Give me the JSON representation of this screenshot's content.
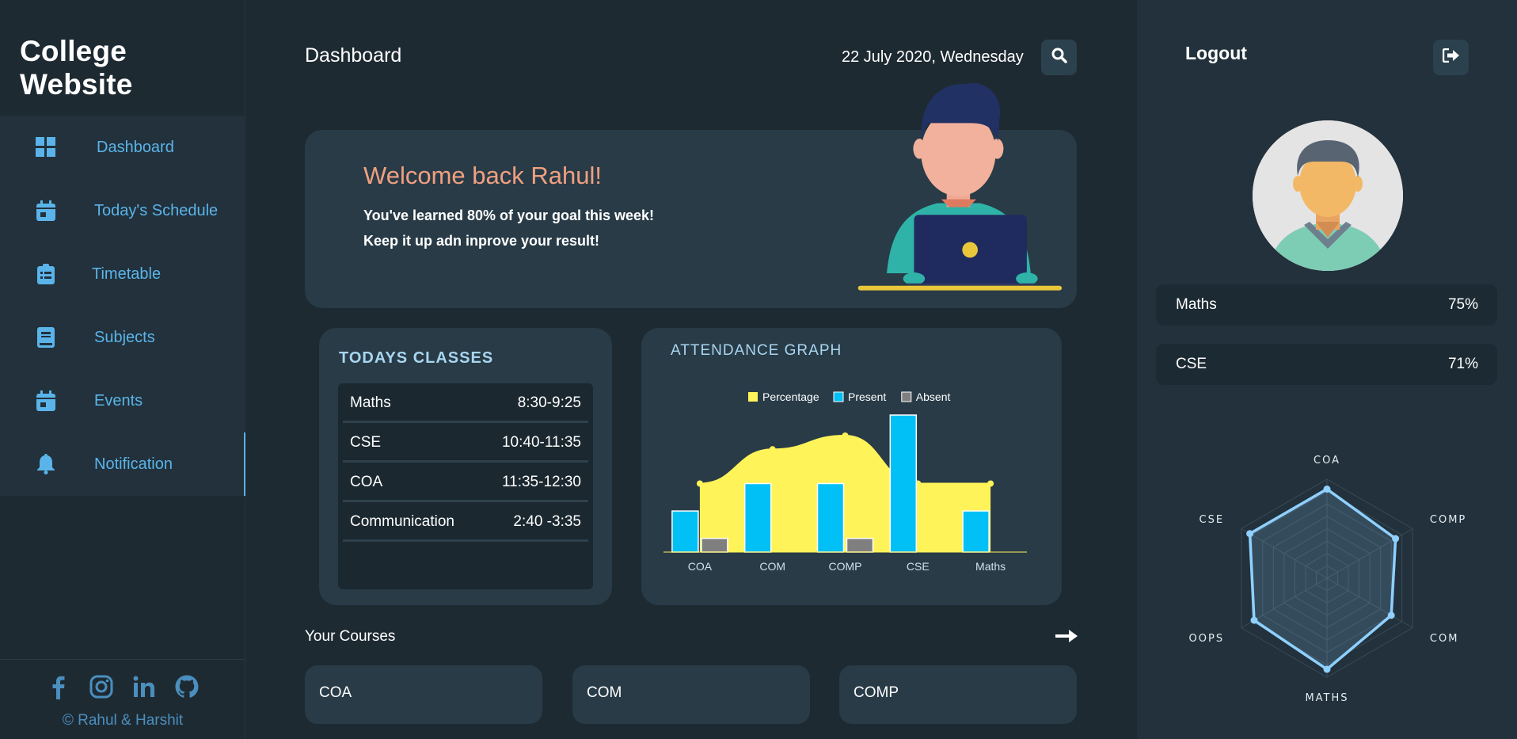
{
  "sidebar": {
    "brand": "College Website",
    "items": [
      {
        "label": "Dashboard",
        "icon": "dashboard-grid-icon"
      },
      {
        "label": "Today's Schedule",
        "icon": "calendar-icon"
      },
      {
        "label": "Timetable",
        "icon": "clipboard-icon"
      },
      {
        "label": "Subjects",
        "icon": "book-icon"
      },
      {
        "label": "Events",
        "icon": "calendar-icon"
      },
      {
        "label": "Notification",
        "icon": "bell-icon"
      }
    ],
    "social": [
      "facebook-icon",
      "instagram-icon",
      "linkedin-icon",
      "github-icon"
    ],
    "copyright": "© Rahul & Harshit"
  },
  "header": {
    "title": "Dashboard",
    "date": "22 July 2020, Wednesday"
  },
  "welcome": {
    "heading": "Welcome back Rahul!",
    "line1": "You've learned 80% of your goal this week!",
    "line2": "Keep it up adn inprove your result!"
  },
  "classes": {
    "title": "TODAYS CLASSES",
    "rows": [
      {
        "subject": "Maths",
        "time": "8:30-9:25"
      },
      {
        "subject": "CSE",
        "time": "10:40-11:35"
      },
      {
        "subject": "COA",
        "time": "11:35-12:30"
      },
      {
        "subject": "Communication",
        "time": "2:40 -3:35"
      }
    ]
  },
  "attendance": {
    "title": "ATTENDANCE GRAPH"
  },
  "chart_data": {
    "type": "bar",
    "categories": [
      "COA",
      "COM",
      "COMP",
      "CSE",
      "Maths"
    ],
    "series": [
      {
        "name": "Percentage",
        "kind": "area",
        "color": "#fff35a",
        "values": [
          5,
          7.5,
          8.5,
          5,
          5
        ]
      },
      {
        "name": "Present",
        "kind": "bar",
        "color": "#00c0f5",
        "values": [
          3,
          5,
          5,
          10,
          3
        ]
      },
      {
        "name": "Absent",
        "kind": "bar",
        "color": "#7f7f7f",
        "values": [
          1,
          0,
          1,
          0,
          0
        ]
      }
    ],
    "legend_position": "top",
    "ylim": [
      0,
      10
    ]
  },
  "courses": {
    "title": "Your Courses",
    "items": [
      "COA",
      "COM",
      "COMP"
    ]
  },
  "right": {
    "logout": "Logout",
    "stats": [
      {
        "subject": "Maths",
        "value": "75%"
      },
      {
        "subject": "CSE",
        "value": "71%"
      }
    ],
    "radar": {
      "axes": [
        "COA",
        "COMP",
        "COM",
        "MATHS",
        "OOPS",
        "CSE"
      ],
      "values": [
        0.9,
        0.8,
        0.75,
        0.92,
        0.85,
        0.9
      ],
      "max": 1,
      "color": "#8fd0ff"
    }
  },
  "colors": {
    "accent": "#5ab4ea",
    "welcome_heading": "#f0a080"
  }
}
